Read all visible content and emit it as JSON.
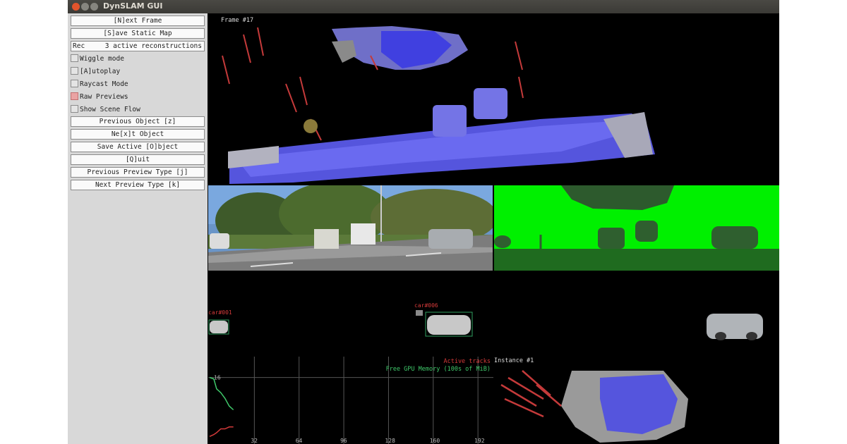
{
  "window": {
    "title": "DynSLAM GUI"
  },
  "panel": {
    "next_frame": "[N]ext Frame",
    "save_static_map": "[S]ave Static Map",
    "rec_label": "Rec",
    "rec_value": "3 active reconstructions",
    "wiggle_mode": "Wiggle mode",
    "autoplay": "[A]utoplay",
    "raycast_mode": "Raycast Mode",
    "raw_previews": "Raw Previews",
    "show_scene_flow": "Show Scene Flow",
    "previous_object": "Previous Object [z]",
    "next_object": "Ne[x]t Object",
    "save_active_object": "Save Active [O]bject",
    "quit": "[Q]uit",
    "previous_preview_type": "Previous Preview Type [j]",
    "next_preview_type": "Next Preview Type [k]",
    "raw_previews_checked": true
  },
  "views": {
    "frame_label": "Frame #17",
    "instance_label": "Instance #1",
    "track1_label": "car#001",
    "track2_label": "car#006"
  },
  "chart_data": {
    "type": "line",
    "legend": [
      "Active tracks",
      "Free GPU Memory (100s of MiB)"
    ],
    "x_ticks": [
      "32",
      "64",
      "96",
      "128",
      "160",
      "192"
    ],
    "y_ticks": [
      "16"
    ],
    "series": [
      {
        "name": "Free GPU Memory (100s of MiB)",
        "x": [
          0,
          3,
          5,
          8,
          11,
          14,
          17
        ],
        "y": [
          16,
          15.6,
          13,
          12,
          10.5,
          8.5,
          7.5
        ]
      },
      {
        "name": "Active tracks",
        "x": [
          0,
          3,
          5,
          8,
          11,
          14,
          17
        ],
        "y": [
          0.5,
          1,
          1.5,
          2.5,
          2.5,
          3,
          3
        ]
      }
    ],
    "colors": {
      "Active tracks": "#d43a3a",
      "Free GPU Memory (100s of MiB)": "#3fc86a"
    }
  }
}
